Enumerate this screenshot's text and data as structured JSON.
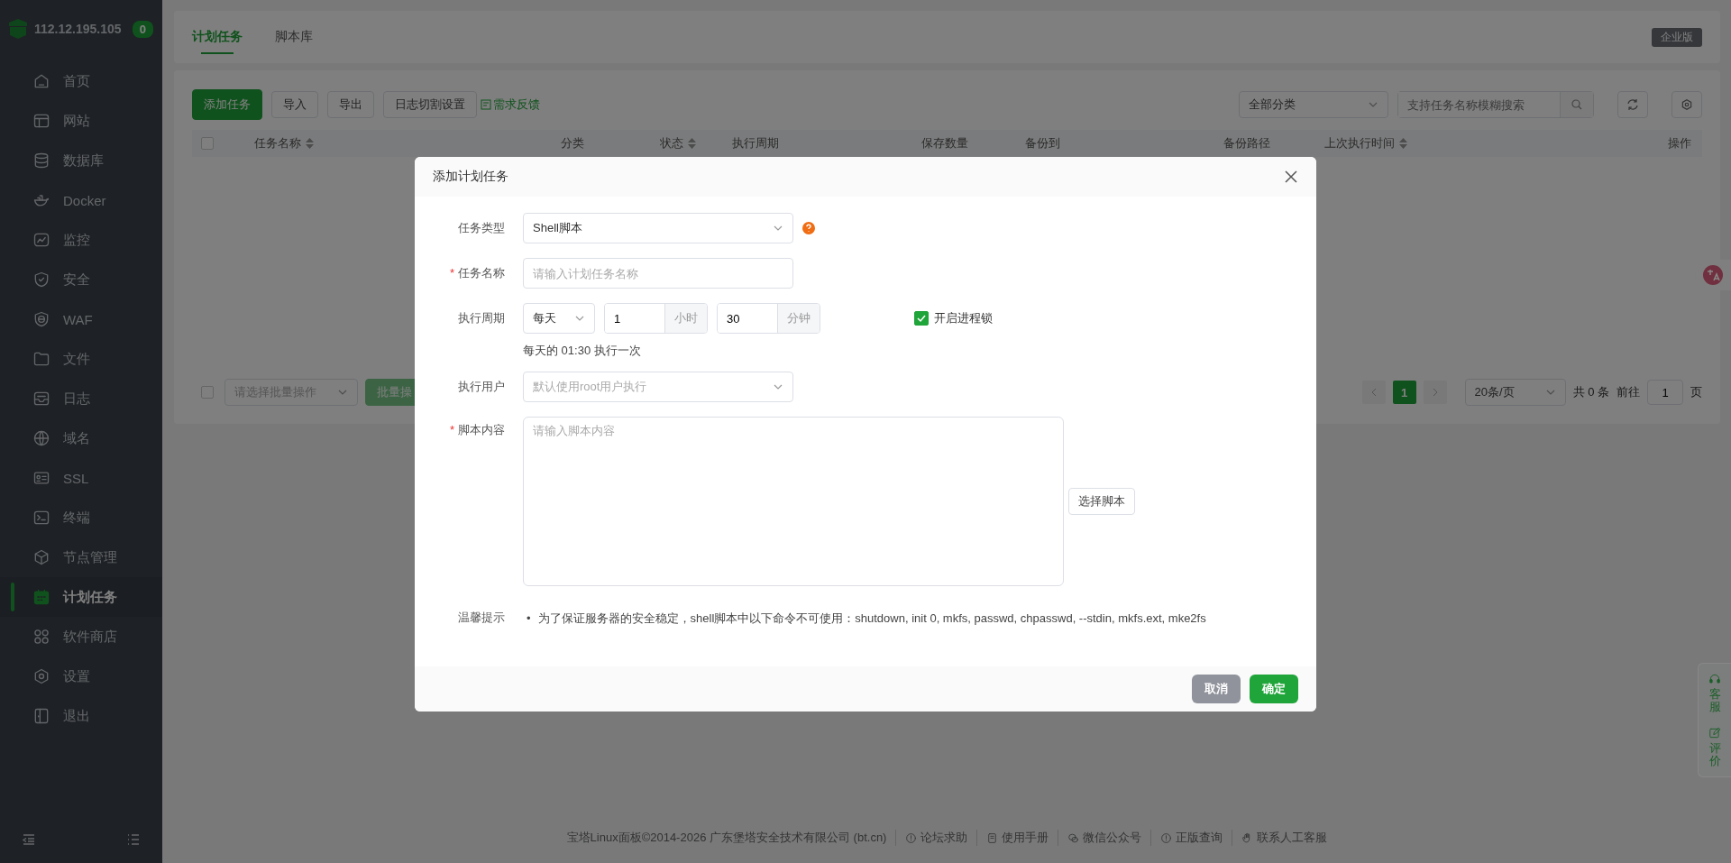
{
  "sidebar": {
    "host": "112.12.195.105",
    "badge": "0",
    "items": [
      {
        "label": "首页",
        "selected": false
      },
      {
        "label": "网站",
        "selected": false
      },
      {
        "label": "数据库",
        "selected": false
      },
      {
        "label": "Docker",
        "selected": false
      },
      {
        "label": "监控",
        "selected": false
      },
      {
        "label": "安全",
        "selected": false
      },
      {
        "label": "WAF",
        "selected": false
      },
      {
        "label": "文件",
        "selected": false
      },
      {
        "label": "日志",
        "selected": false
      },
      {
        "label": "域名",
        "selected": false
      },
      {
        "label": "SSL",
        "selected": false
      },
      {
        "label": "终端",
        "selected": false
      },
      {
        "label": "节点管理",
        "selected": false
      },
      {
        "label": "计划任务",
        "selected": true
      },
      {
        "label": "软件商店",
        "selected": false
      },
      {
        "label": "设置",
        "selected": false
      },
      {
        "label": "退出",
        "selected": false
      }
    ]
  },
  "tabs": [
    {
      "label": "计划任务",
      "selected": true
    },
    {
      "label": "脚本库",
      "selected": false
    }
  ],
  "edition_badge": "企业版",
  "toolbar": {
    "buttons": [
      {
        "label": "添加任务",
        "kind": "primary"
      },
      {
        "label": "导入",
        "kind": "default"
      },
      {
        "label": "导出",
        "kind": "default"
      },
      {
        "label": "日志切割设置",
        "kind": "default"
      }
    ],
    "feedback_link": "需求反馈",
    "category_select": "全部分类",
    "search": {
      "placeholder": "支持任务名称模糊搜索"
    }
  },
  "table": {
    "select_all_checked": false,
    "columns": [
      {
        "label": "任务名称",
        "sortable": true
      },
      {
        "label": "分类",
        "sortable": false
      },
      {
        "label": "状态",
        "sortable": true
      },
      {
        "label": "执行周期",
        "sortable": false
      },
      {
        "label": "保存数量",
        "sortable": false
      },
      {
        "label": "备份到",
        "sortable": false
      },
      {
        "label": "备份路径",
        "sortable": false
      },
      {
        "label": "上次执行时间",
        "sortable": true
      },
      {
        "label": "操作",
        "sortable": false
      }
    ]
  },
  "batch": {
    "checked": false,
    "select_placeholder": "请选择批量操作",
    "button": "批量操"
  },
  "pagination": {
    "pages": [
      {
        "label": "1",
        "selected": true
      }
    ],
    "page_size": "20条/页",
    "total": "共 0 条",
    "goto_label": "前往",
    "goto_value": "1",
    "goto_suffix": "页"
  },
  "footer": {
    "copyright": "宝塔Linux面板©2014-2026 广东堡塔安全技术有限公司 (bt.cn)",
    "links": [
      {
        "label": "论坛求助"
      },
      {
        "label": "使用手册"
      },
      {
        "label": "微信公众号"
      },
      {
        "label": "正版查询"
      },
      {
        "label": "联系人工客服"
      }
    ]
  },
  "side_float": [
    {
      "label": "客服"
    },
    {
      "label": "评价"
    }
  ],
  "dialog": {
    "title": "添加计划任务",
    "task_type": {
      "label": "任务类型",
      "value": "Shell脚本"
    },
    "task_name": {
      "label": "任务名称",
      "required_mark": "*",
      "placeholder": "请输入计划任务名称"
    },
    "schedule": {
      "label": "执行周期",
      "period": "每天",
      "hour": "1",
      "hour_unit": "小时",
      "minute": "30",
      "minute_unit": "分钟",
      "summary": "每天的 01:30 执行一次"
    },
    "process_lock": {
      "label": "开启进程锁",
      "checked": true
    },
    "run_user": {
      "label": "执行用户",
      "placeholder": "默认使用root用户执行"
    },
    "script": {
      "label": "脚本内容",
      "required_mark": "*",
      "placeholder": "请输入脚本内容",
      "pick_button": "选择脚本"
    },
    "tips": {
      "label": "温馨提示",
      "items": [
        {
          "bullet": "•",
          "text": "为了保证服务器的安全稳定，shell脚本中以下命令不可使用：shutdown, init 0, mkfs, passwd, chpasswd, --stdin, mkfs.ext, mke2fs"
        }
      ]
    },
    "buttons": [
      {
        "label": "取消",
        "kind": "cancel"
      },
      {
        "label": "确定",
        "kind": "confirm"
      }
    ]
  }
}
